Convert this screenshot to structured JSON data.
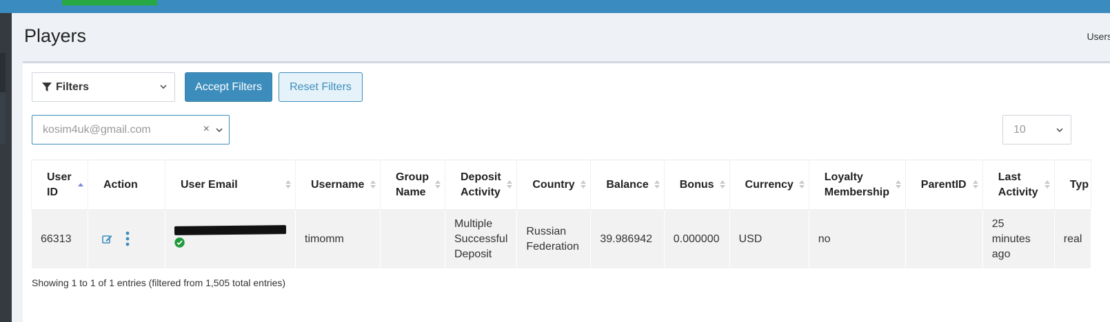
{
  "page": {
    "title": "Players",
    "breadcrumb": "Users"
  },
  "filters": {
    "select_label": "Filters",
    "accept_label": "Accept Filters",
    "reset_label": "Reset Filters",
    "email_value": "kosim4uk@gmail.com",
    "clear_glyph": "×",
    "page_length": "10"
  },
  "table": {
    "headers": {
      "user_id": "User ID",
      "action": "Action",
      "user_email": "User Email",
      "username": "Username",
      "group_name": "Group Name",
      "deposit_activity": "Deposit Activity",
      "country": "Country",
      "balance": "Balance",
      "bonus": "Bonus",
      "currency": "Currency",
      "loyalty_membership": "Loyalty Membership",
      "parent_id": "ParentID",
      "last_activity": "Last Activity",
      "type": "Typ"
    },
    "row": {
      "user_id": "66313",
      "username": "timomm",
      "group_name": "",
      "deposit_activity": "Multiple Successful Deposit",
      "country": "Russian Federation",
      "balance": "39.986942",
      "bonus": "0.000000",
      "currency": "USD",
      "loyalty_membership": "no",
      "parent_id": "",
      "last_activity": "25 minutes ago",
      "type": "real"
    },
    "info": "Showing 1 to 1 of 1 entries (filtered from 1,505 total entries)"
  },
  "colors": {
    "topbar": "#3a8bbf",
    "primary": "#3c8dbc",
    "success": "#28a745",
    "sort_active": "#7b85e0"
  }
}
